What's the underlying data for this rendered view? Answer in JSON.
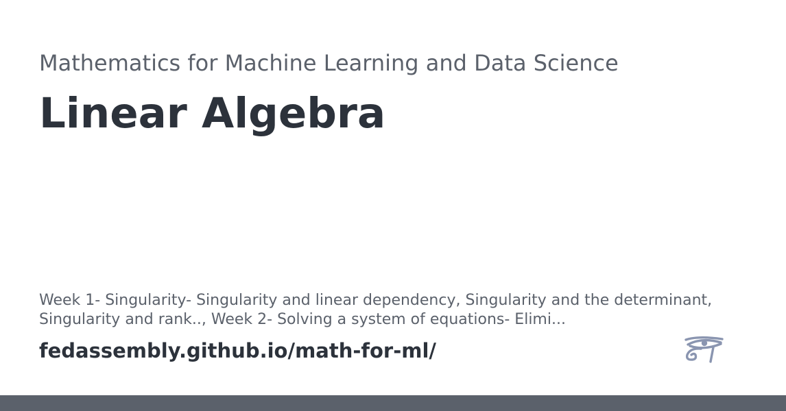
{
  "site": {
    "subtitle": "Mathematics for Machine Learning and Data Science",
    "title": "Linear Algebra",
    "description": "Week 1- Singularity- Singularity and linear dependency, Singularity and the determinant, Singularity and rank.., Week 2- Solving a system of equations- Elimi...",
    "url": "fedassembly.github.io/math-for-ml/"
  },
  "logo": {
    "icon": "eye-of-horus-icon",
    "color": "#8a95b0"
  },
  "colors": {
    "title": "#2c323b",
    "muted": "#5b616b",
    "bar": "#5b616b",
    "background": "#ffffff"
  }
}
